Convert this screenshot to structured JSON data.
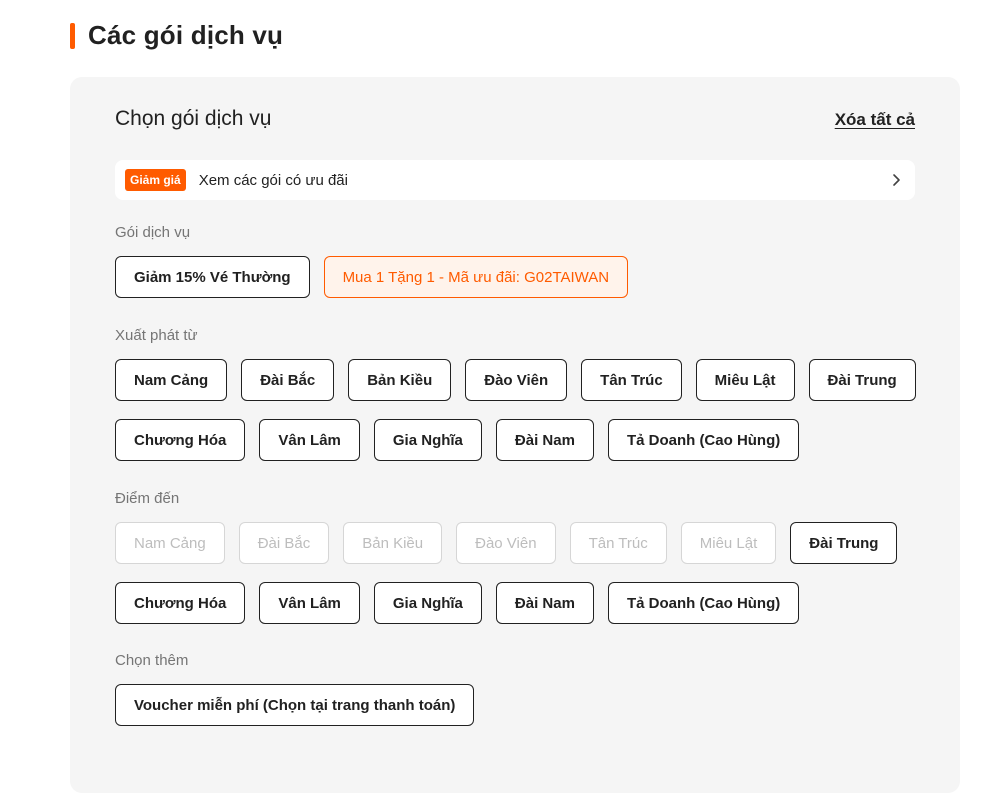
{
  "page": {
    "title": "Các gói dịch vụ"
  },
  "panel": {
    "title": "Chọn gói dịch vụ",
    "clear_all": "Xóa tất cả"
  },
  "promo": {
    "badge": "Giảm giá",
    "text": "Xem các gói có ưu đãi"
  },
  "packages": {
    "label": "Gói dịch vụ",
    "options": [
      "Giảm 15% Vé Thường",
      "Mua 1 Tặng 1 - Mã ưu đãi: G02TAIWAN"
    ],
    "selected": "Mua 1 Tặng 1 - Mã ưu đãi: G02TAIWAN"
  },
  "departure": {
    "label": "Xuất phát từ",
    "options": [
      "Nam Cảng",
      "Đài Bắc",
      "Bản Kiều",
      "Đào Viên",
      "Tân Trúc",
      "Miêu Lật",
      "Đài Trung",
      "Chương Hóa",
      "Vân Lâm",
      "Gia Nghĩa",
      "Đài Nam",
      "Tả Doanh (Cao Hùng)"
    ]
  },
  "destination": {
    "label": "Điểm đến",
    "options": [
      "Nam Cảng",
      "Đài Bắc",
      "Bản Kiều",
      "Đào Viên",
      "Tân Trúc",
      "Miêu Lật",
      "Đài Trung",
      "Chương Hóa",
      "Vân Lâm",
      "Gia Nghĩa",
      "Đài Nam",
      "Tả Doanh (Cao Hùng)"
    ],
    "disabled": [
      "Nam Cảng",
      "Đài Bắc",
      "Bản Kiều",
      "Đào Viên",
      "Tân Trúc",
      "Miêu Lật"
    ]
  },
  "extras": {
    "label": "Chọn thêm",
    "options": [
      "Voucher miễn phí (Chọn tại trang thanh toán)"
    ]
  },
  "colors": {
    "accent": "#ff5b00",
    "panel_bg": "#f5f5f5",
    "text": "#212121",
    "muted": "#757575",
    "disabled": "#bdbdbd"
  },
  "icons": {
    "promo_arrow": "chevron-right-icon"
  }
}
